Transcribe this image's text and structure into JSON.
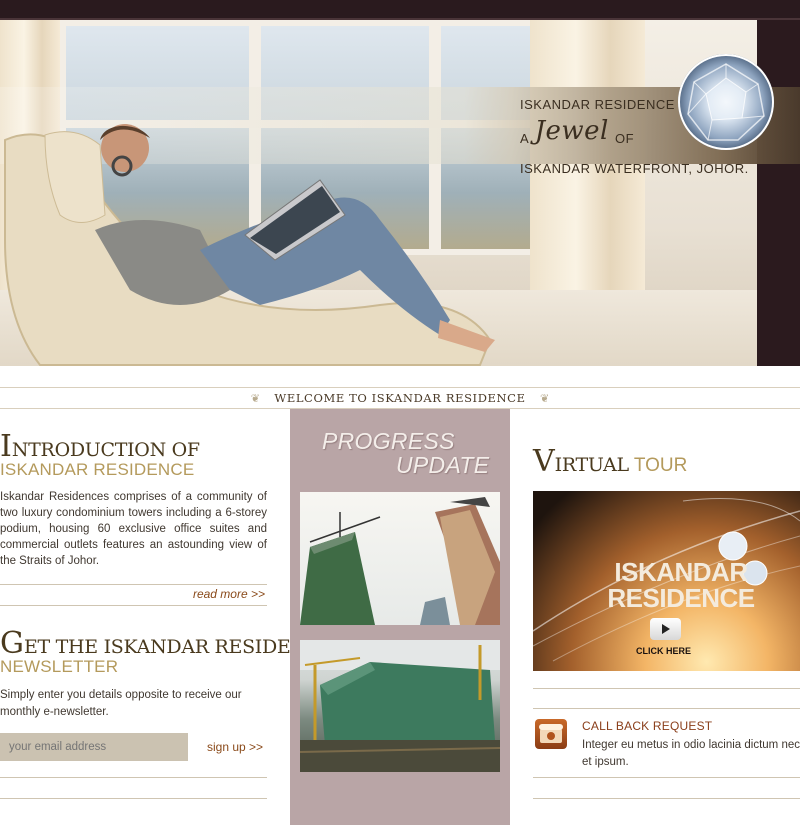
{
  "hero": {
    "line1": "ISKANDAR RESIDENCE",
    "line2_pre": "A",
    "line2_jewel": "Jewel",
    "line2_post": "OF",
    "line3": "ISKANDAR WATERFRONT, JOHOR."
  },
  "welcome": {
    "text": "WELCOME TO ISKANDAR RESIDENCE"
  },
  "intro": {
    "title_cap": "I",
    "title_rest": "NTRODUCTION OF",
    "subtitle": "ISKANDAR RESIDENCE",
    "body": "Iskandar Residences comprises of a community of two luxury condominium towers including a 6-storey podium, housing 60 exclusive office suites and commercial outlets features an astounding view of the Straits of Johor.",
    "read_more": "read more >>"
  },
  "newsletter": {
    "title_cap": "G",
    "title_rest": "ET THE ISKANDAR RESIDENCE",
    "subtitle": "NEWSLETTER",
    "body": "Simply enter you details opposite to receive our monthly e-newsletter.",
    "email_placeholder": "your email address",
    "signup": "sign up >>"
  },
  "progress": {
    "line1": "PROGRESS",
    "line2": "UPDATE"
  },
  "virtual_tour": {
    "title_cap": "V",
    "title_rest": "IRTUAL",
    "title_tour": "TOUR",
    "banner_line1": "ISKANDAR",
    "banner_line2": "RESIDENCE",
    "click_here": "CLICK HERE"
  },
  "callback": {
    "title": "CALL BACK REQUEST",
    "text": "Integer eu metus in odio lacinia dictum nec et ipsum."
  }
}
